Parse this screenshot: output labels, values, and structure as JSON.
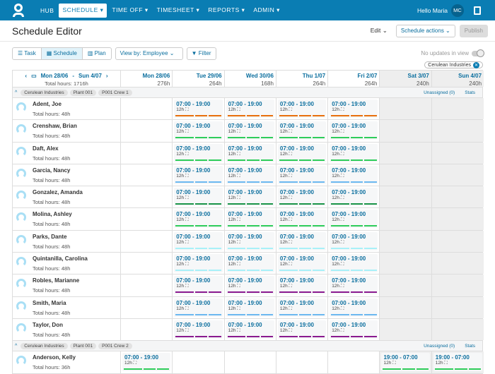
{
  "nav": {
    "items": [
      {
        "label": "HUB",
        "active": false
      },
      {
        "label": "SCHEDULE ▾",
        "active": true
      },
      {
        "label": "TIME OFF ▾",
        "active": false
      },
      {
        "label": "TIMESHEET ▾",
        "active": false
      },
      {
        "label": "REPORTS ▾",
        "active": false
      },
      {
        "label": "ADMIN ▾",
        "active": false
      }
    ],
    "greeting": "Hello Maria",
    "initials": "MC"
  },
  "header": {
    "title": "Schedule Editor",
    "edit": "Edit ⌄",
    "schedule_actions": "Schedule actions ⌄",
    "publish": "Publish"
  },
  "toolbar": {
    "views": [
      {
        "label": "☰ Task",
        "active": false
      },
      {
        "label": "▦ Schedule",
        "active": true
      },
      {
        "label": "▥ Plan",
        "active": false
      }
    ],
    "view_by": "View by: Employee ⌄",
    "filter": "▼ Filter",
    "no_updates": "No updates in view",
    "filter_chip": "Cerulean Industries"
  },
  "range": {
    "prev": "‹",
    "cal": "▭",
    "start": "Mon 28/06",
    "sep": "-",
    "end": "Sun 4/07",
    "next": "›",
    "total": "Total hours: 1716h"
  },
  "days": [
    {
      "label": "Mon 28/06",
      "hours": "276h"
    },
    {
      "label": "Tue 29/06",
      "hours": "264h"
    },
    {
      "label": "Wed 30/06",
      "hours": "168h"
    },
    {
      "label": "Thu 1/07",
      "hours": "264h"
    },
    {
      "label": "Fri 2/07",
      "hours": "264h"
    },
    {
      "label": "Sat 3/07",
      "hours": "240h",
      "weekend": true
    },
    {
      "label": "Sun 4/07",
      "hours": "240h",
      "weekend": true
    }
  ],
  "groups": [
    {
      "chips": [
        "Cerulean Industries",
        "Plant 001",
        "P001 Crew 1"
      ],
      "unassigned": "Unassigned (0)",
      "stats": "Stats",
      "employees": [
        {
          "name": "Adent, Joe",
          "hours": "Total hours: 48h",
          "color": "#e8700c",
          "shifts": [
            null,
            "07:00 - 19:00",
            "07:00 - 19:00",
            "07:00 - 19:00",
            "07:00 - 19:00",
            null,
            null
          ]
        },
        {
          "name": "Crenshaw, Brian",
          "hours": "Total hours: 48h",
          "color": "#2ecc5a",
          "shifts": [
            null,
            "07:00 - 19:00",
            "07:00 - 19:00",
            "07:00 - 19:00",
            "07:00 - 19:00",
            null,
            null
          ]
        },
        {
          "name": "Daft, Alex",
          "hours": "Total hours: 48h",
          "color": "#2ecc5a",
          "shifts": [
            null,
            "07:00 - 19:00",
            "07:00 - 19:00",
            "07:00 - 19:00",
            "07:00 - 19:00",
            null,
            null
          ]
        },
        {
          "name": "Garcia, Nancy",
          "hours": "Total hours: 48h",
          "color": "#6cb8f0",
          "shifts": [
            null,
            "07:00 - 19:00",
            "07:00 - 19:00",
            "07:00 - 19:00",
            "07:00 - 19:00",
            null,
            null
          ]
        },
        {
          "name": "Gonzalez, Amanda",
          "hours": "Total hours: 48h",
          "color": "#1a9448",
          "shifts": [
            null,
            "07:00 - 19:00",
            "07:00 - 19:00",
            "07:00 - 19:00",
            "07:00 - 19:00",
            null,
            null
          ]
        },
        {
          "name": "Molina, Ashley",
          "hours": "Total hours: 48h",
          "color": "#2ecc5a",
          "shifts": [
            null,
            "07:00 - 19:00",
            "07:00 - 19:00",
            "07:00 - 19:00",
            "07:00 - 19:00",
            null,
            null
          ]
        },
        {
          "name": "Parks, Dante",
          "hours": "Total hours: 48h",
          "color": "#a8f0f8",
          "shifts": [
            null,
            "07:00 - 19:00",
            "07:00 - 19:00",
            "07:00 - 19:00",
            "07:00 - 19:00",
            null,
            null
          ]
        },
        {
          "name": "Quintanilla, Carolina",
          "hours": "Total hours: 48h",
          "color": "#a8f0f8",
          "shifts": [
            null,
            "07:00 - 19:00",
            "07:00 - 19:00",
            "07:00 - 19:00",
            "07:00 - 19:00",
            null,
            null
          ]
        },
        {
          "name": "Robles, Marianne",
          "hours": "Total hours: 48h",
          "color": "#8a1a8f",
          "shifts": [
            null,
            "07:00 - 19:00",
            "07:00 - 19:00",
            "07:00 - 19:00",
            "07:00 - 19:00",
            null,
            null
          ]
        },
        {
          "name": "Smith, Maria",
          "hours": "Total hours: 48h",
          "color": "#6cb8f0",
          "shifts": [
            null,
            "07:00 - 19:00",
            "07:00 - 19:00",
            "07:00 - 19:00",
            "07:00 - 19:00",
            null,
            null
          ]
        },
        {
          "name": "Taylor, Don",
          "hours": "Total hours: 48h",
          "color": "#8a1a8f",
          "shifts": [
            null,
            "07:00 - 19:00",
            "07:00 - 19:00",
            "07:00 - 19:00",
            "07:00 - 19:00",
            null,
            null
          ]
        }
      ]
    },
    {
      "chips": [
        "Cerulean Industries",
        "Plant 001",
        "P001 Crew 2"
      ],
      "unassigned": "Unassigned (0)",
      "stats": "Stats",
      "employees": [
        {
          "name": "Anderson, Kelly",
          "hours": "Total hours: 36h",
          "color": "#2ecc5a",
          "shifts": [
            "07:00 - 19:00",
            null,
            null,
            null,
            null,
            "19:00 - 07:00",
            "19:00 - 07:00"
          ]
        }
      ]
    }
  ],
  "shift_duration": "12h ⛶"
}
